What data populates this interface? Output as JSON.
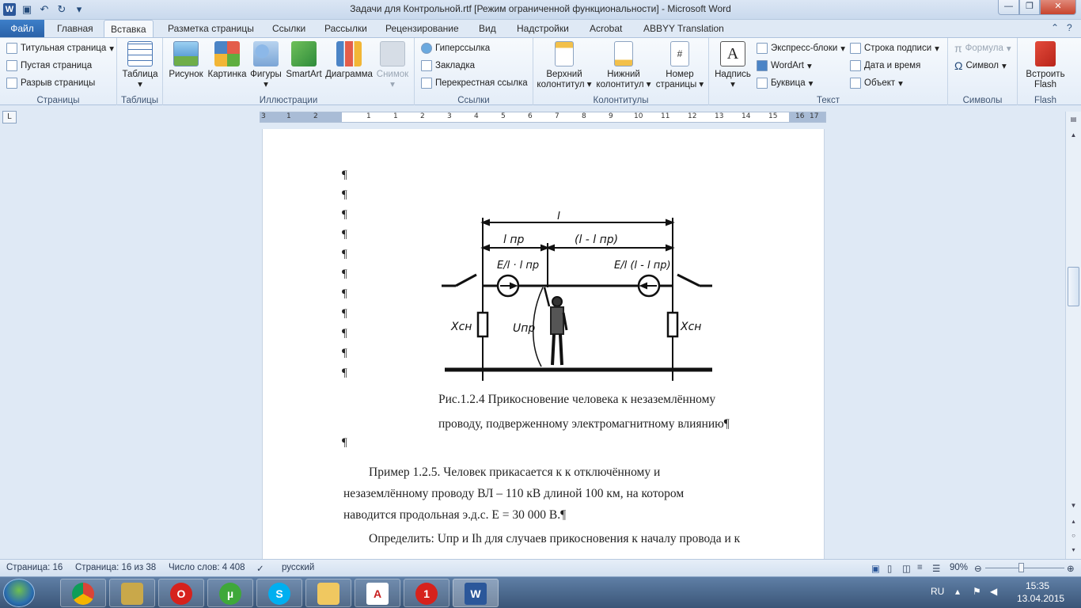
{
  "window": {
    "title": "Задачи для Контрольной.rtf [Режим ограниченной функциональности]  -  Microsoft Word",
    "app_icon": "W"
  },
  "tabs": {
    "file": "Файл",
    "items": [
      "Главная",
      "Вставка",
      "Разметка страницы",
      "Ссылки",
      "Рассылки",
      "Рецензирование",
      "Вид",
      "Надстройки",
      "Acrobat",
      "ABBYY Translation"
    ]
  },
  "ribbon": {
    "pages": {
      "label": "Страницы",
      "items": [
        "Титульная страница",
        "Пустая страница",
        "Разрыв страницы"
      ]
    },
    "tables": {
      "label": "Таблицы",
      "button": "Таблица"
    },
    "illustrations": {
      "label": "Иллюстрации",
      "items": [
        "Рисунок",
        "Картинка",
        "Фигуры",
        "SmartArt",
        "Диаграмма",
        "Снимок"
      ]
    },
    "links": {
      "label": "Ссылки",
      "items": [
        "Гиперссылка",
        "Закладка",
        "Перекрестная ссылка"
      ]
    },
    "headers": {
      "label": "Колонтитулы",
      "top1": "Верхний",
      "top2": "колонтитул",
      "bottom1": "Нижний",
      "bottom2": "колонтитул",
      "num1": "Номер",
      "num2": "страницы"
    },
    "text": {
      "label": "Текст",
      "textbox": "Надпись",
      "items": [
        "Экспресс-блоки",
        "WordArt",
        "Буквица",
        "Строка подписи",
        "Дата и время",
        "Объект"
      ]
    },
    "symbols": {
      "label": "Символы",
      "formula": "Формула",
      "symbol": "Символ"
    },
    "flash": {
      "label": "Flash",
      "line1": "Встроить",
      "line2": "Flash"
    }
  },
  "ruler": {
    "ticks": [
      "3",
      "1",
      "2",
      "1",
      "1",
      "2",
      "3",
      "4",
      "5",
      "6",
      "7",
      "8",
      "9",
      "10",
      "11",
      "12",
      "13",
      "14",
      "15",
      "16",
      "17"
    ]
  },
  "document": {
    "pilcrow": "¶",
    "figure_labels": {
      "top_span": "l",
      "left_span": "l пр",
      "right_span": "(l - l пр)",
      "left_emf": "E/l · l пр",
      "right_emf": "E/l (l - l пр)",
      "left_x": "Xсн",
      "right_x": "Xсн",
      "u_label": "Uпр"
    },
    "caption_line1": "Рис.1.2.4 Прикосновение человека к незаземлённому",
    "caption_line2": "проводу, подверженному электромагнитному влиянию¶",
    "example_line1": "Пример 1.2.5. Человек прикасается к к отключённому и",
    "example_line2": "незаземлённому проводу ВЛ – 110 кВ длиной 100 км, на котором",
    "example_line3": "наводится продольная э.д.с. E = 30 000 В.¶",
    "task_line": "Определить: Uпр и Ih для случаев прикосновения к началу провода и к"
  },
  "status": {
    "page": "Страница: 16",
    "page_of": "Страница: 16 из 38",
    "words": "Число слов: 4 408",
    "language": "русский",
    "zoom": "90%",
    "zoom_level": 0.9
  },
  "taskbar": {
    "apps": [
      "chrome",
      "explorer-tool",
      "opera",
      "utorrent",
      "skype",
      "folder",
      "acrobat",
      "notification-app",
      "word"
    ],
    "lang": "RU",
    "time": "15:35",
    "date": "13.04.2015"
  },
  "colors": {
    "accent": "#2b579a",
    "ribbon_bg": "#e4edf8",
    "chrome_bg": "#dfe9f5"
  }
}
